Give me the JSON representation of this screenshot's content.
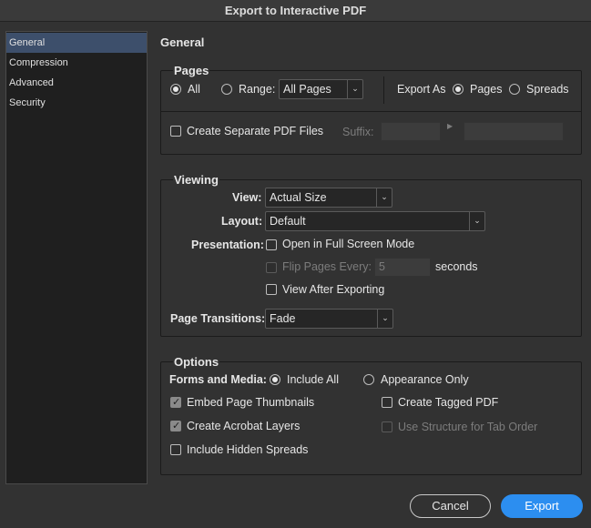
{
  "window": {
    "title": "Export to Interactive PDF"
  },
  "sidebar": {
    "items": [
      {
        "label": "General"
      },
      {
        "label": "Compression"
      },
      {
        "label": "Advanced"
      },
      {
        "label": "Security"
      }
    ]
  },
  "panel_title": "General",
  "pages": {
    "heading": "Pages",
    "all_label": "All",
    "range_label": "Range:",
    "range_value": "All Pages",
    "export_as_label": "Export As",
    "pages_label": "Pages",
    "spreads_label": "Spreads",
    "separate_label": "Create Separate PDF Files",
    "suffix_label": "Suffix:"
  },
  "viewing": {
    "heading": "Viewing",
    "view_label": "View:",
    "view_value": "Actual Size",
    "layout_label": "Layout:",
    "layout_value": "Default",
    "presentation_label": "Presentation:",
    "fullscreen_label": "Open in Full Screen Mode",
    "flip_label": "Flip Pages Every:",
    "flip_value": "5",
    "seconds_label": "seconds",
    "view_after_label": "View After Exporting",
    "transitions_label": "Page Transitions:",
    "transitions_value": "Fade"
  },
  "options": {
    "heading": "Options",
    "forms_label": "Forms and Media:",
    "include_all_label": "Include All",
    "appearance_label": "Appearance Only",
    "thumbnails_label": "Embed Page Thumbnails",
    "tagged_label": "Create Tagged PDF",
    "layers_label": "Create Acrobat Layers",
    "structure_label": "Use Structure for Tab Order",
    "hidden_label": "Include Hidden Spreads"
  },
  "buttons": {
    "cancel": "Cancel",
    "export": "Export"
  }
}
